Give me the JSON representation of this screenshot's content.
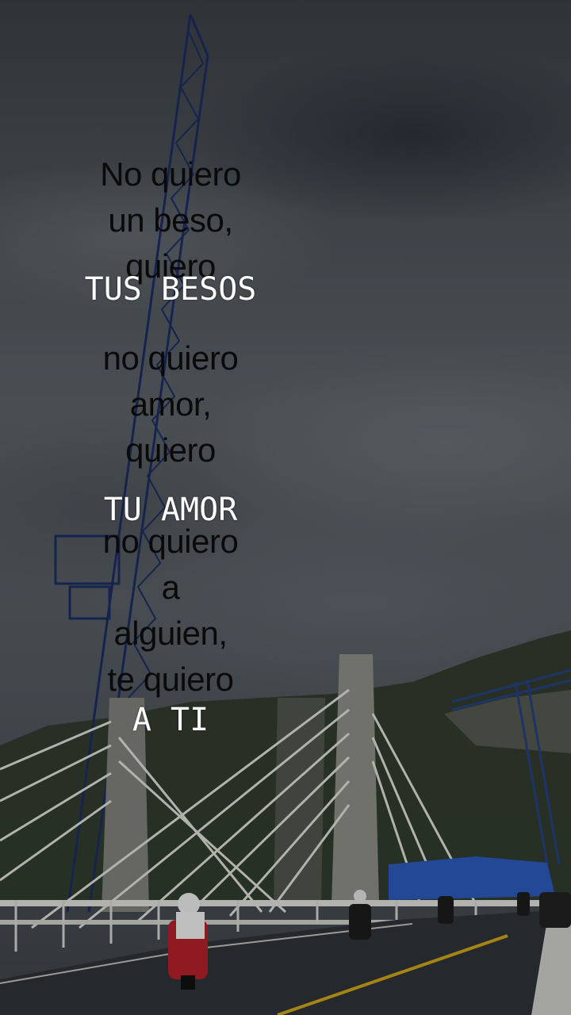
{
  "lyrics": {
    "block1": [
      "No quiero",
      "un beso,",
      "quiero"
    ],
    "accent1": "TUS BESOS",
    "block2": [
      "no quiero",
      "amor,",
      "quiero"
    ],
    "accent2": "TU AMOR",
    "block3": [
      "no quiero",
      "a",
      "alguien,",
      "te quiero"
    ],
    "accent3": "A TI"
  },
  "scene": {
    "description_icons": [
      "crane-icon",
      "bridge-icon",
      "motorcycle-icon"
    ],
    "colors": {
      "text_dark": "#0a0a0a",
      "text_accent": "#ffffff",
      "crane_blue": "#1f3a7a",
      "road": "#2e3136",
      "road_line": "#c9a21a"
    }
  }
}
